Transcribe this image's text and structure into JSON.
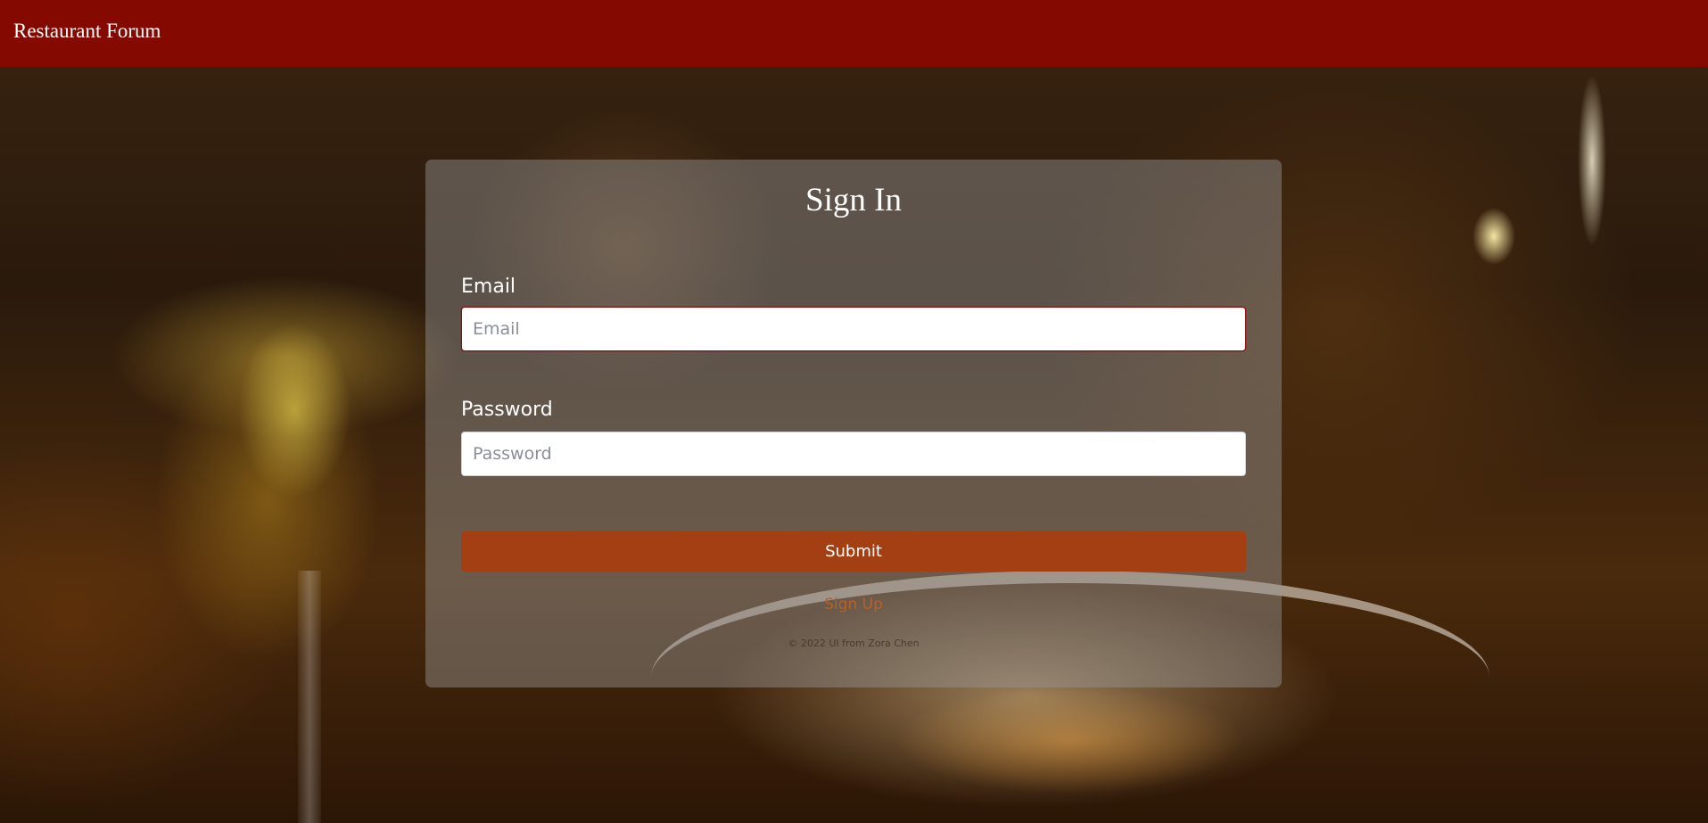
{
  "header": {
    "brand": "Restaurant Forum"
  },
  "signin": {
    "title": "Sign In",
    "email_label": "Email",
    "email_placeholder": "Email",
    "email_value": "",
    "password_label": "Password",
    "password_placeholder": "Password",
    "password_value": "",
    "submit_label": "Submit",
    "signup_link": "Sign Up",
    "footer": "© 2022 UI from Zora Chen"
  },
  "colors": {
    "header_bg": "#8b0800",
    "submit_bg": "#a33f12",
    "signup_link": "#b8602b"
  }
}
